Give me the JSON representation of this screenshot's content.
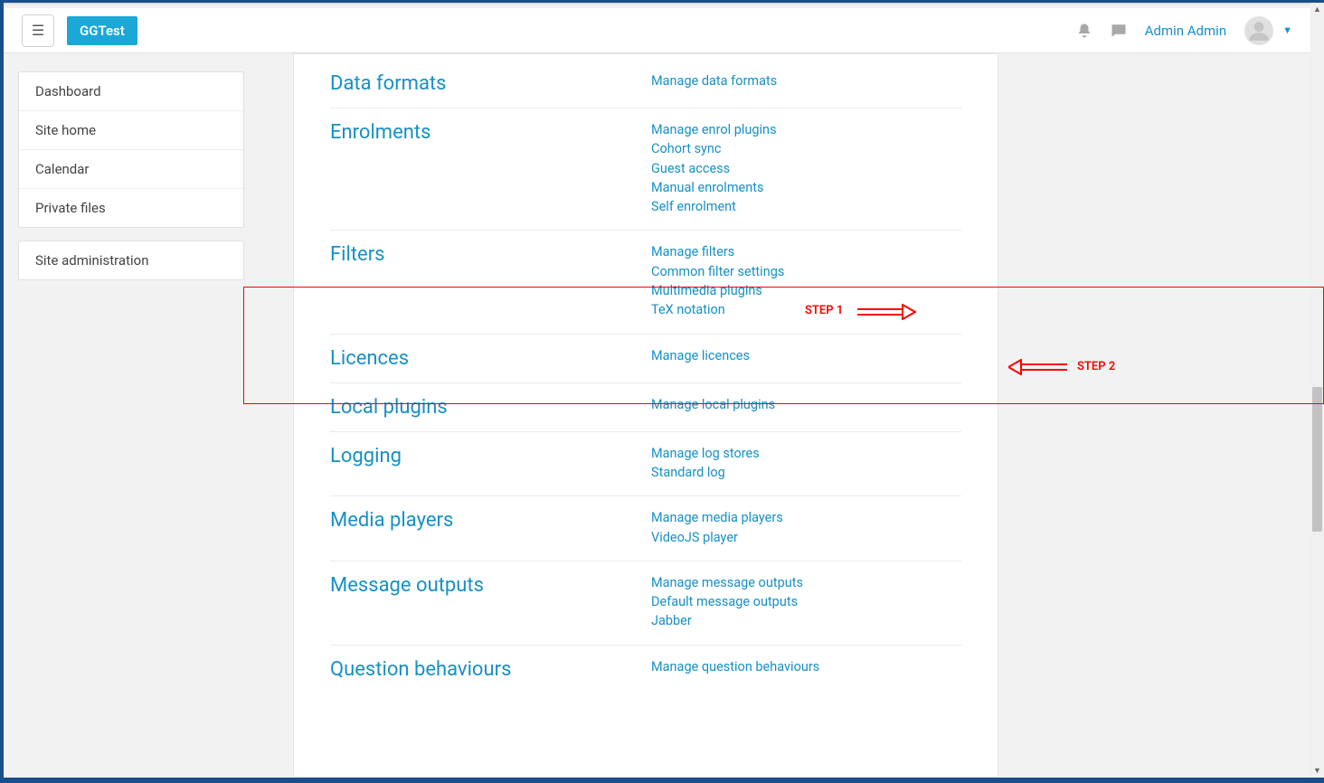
{
  "colors": {
    "brand": "#1ba8d6",
    "link": "#1790c4",
    "annotation": "red"
  },
  "navbar": {
    "brand": "GGTest",
    "hamburger": "☰",
    "user": "Admin Admin"
  },
  "sidebar": {
    "main_nav": [
      {
        "label": "Dashboard"
      },
      {
        "label": "Site home"
      },
      {
        "label": "Calendar"
      },
      {
        "label": "Private files"
      }
    ],
    "admin_nav": [
      {
        "label": "Site administration"
      }
    ]
  },
  "annotations": {
    "step1": "STEP 1",
    "step2": "STEP 2"
  },
  "sections": [
    {
      "heading": "Data formats",
      "links": [
        "Manage data formats"
      ]
    },
    {
      "heading": "Enrolments",
      "links": [
        "Manage enrol plugins",
        "Cohort sync",
        "Guest access",
        "Manual enrolments",
        "Self enrolment"
      ]
    },
    {
      "heading": "Filters",
      "links": [
        "Manage filters",
        "Common filter settings",
        "Multimedia plugins",
        "TeX notation"
      ]
    },
    {
      "heading": "Licences",
      "links": [
        "Manage licences"
      ]
    },
    {
      "heading": "Local plugins",
      "links": [
        "Manage local plugins"
      ]
    },
    {
      "heading": "Logging",
      "links": [
        "Manage log stores",
        "Standard log"
      ]
    },
    {
      "heading": "Media players",
      "links": [
        "Manage media players",
        "VideoJS player"
      ]
    },
    {
      "heading": "Message outputs",
      "links": [
        "Manage message outputs",
        "Default message outputs",
        "Jabber"
      ]
    },
    {
      "heading": "Question behaviours",
      "links": [
        "Manage question behaviours"
      ]
    }
  ]
}
